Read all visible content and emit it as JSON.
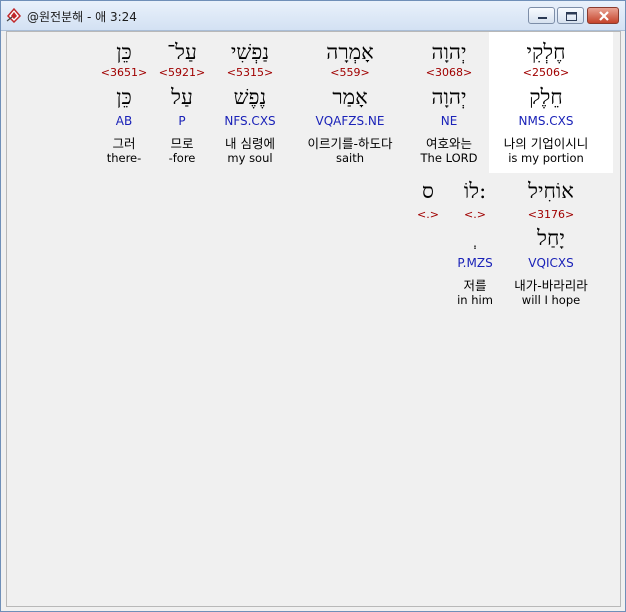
{
  "window": {
    "title": "@원전분해 - 애 3:24"
  },
  "words": [
    {
      "id": "w1",
      "surface": "חֶלְקִי",
      "strong": "<2506>",
      "lemma": "חֵלֶק",
      "parse": "NMS.CXS",
      "korean": "나의 기업이시니",
      "english": "is my portion",
      "highlighted": true
    },
    {
      "id": "w2",
      "surface": "יְהוָה",
      "strong": "<3068>",
      "lemma": "יְהוָה",
      "parse": "NE",
      "korean": "여호와는",
      "english": "The LORD",
      "highlighted": false
    },
    {
      "id": "w3",
      "surface": "אָמְרָה",
      "strong": "<559>",
      "lemma": "אָמַר",
      "parse": "VQAFZS.NE",
      "korean": "이르기를-하도다",
      "english": "saith",
      "highlighted": false
    },
    {
      "id": "w4",
      "surface": "נַפְשִׁי",
      "strong": "<5315>",
      "lemma": "נֶפֶשׁ",
      "parse": "NFS.CXS",
      "korean": "내 심령에",
      "english": "my soul",
      "highlighted": false
    },
    {
      "id": "w5",
      "surface": "עַל־",
      "strong": "<5921>",
      "lemma": "עַל",
      "parse": "P",
      "korean": "므로",
      "english": "-fore",
      "highlighted": false
    },
    {
      "id": "w6",
      "surface": "כֵּן",
      "strong": "<3651>",
      "lemma": "כֵּן",
      "parse": "AB",
      "korean": "그러",
      "english": "there-",
      "highlighted": false
    },
    {
      "id": "w7",
      "surface": "אוֹחִיל",
      "strong": "<3176>",
      "lemma": "יָחַל",
      "parse": "VQICXS",
      "korean": "내가-바라리라",
      "english": "will I hope",
      "highlighted": false
    },
    {
      "id": "w8",
      "surface": "לוֹ:",
      "strong": "<.>",
      "lemma": "",
      "parse": "",
      "korean": "",
      "english": "",
      "highlighted": false
    },
    {
      "id": "w9",
      "surface": "ס",
      "strong": "<.>",
      "lemma": "",
      "parse": "",
      "korean": "",
      "english": "",
      "highlighted": false
    },
    {
      "id": "w10",
      "surface": "",
      "strong": "",
      "lemma": "ְ",
      "parse": "P.MZS",
      "korean": "저를",
      "english": "in him",
      "highlighted": false
    }
  ]
}
